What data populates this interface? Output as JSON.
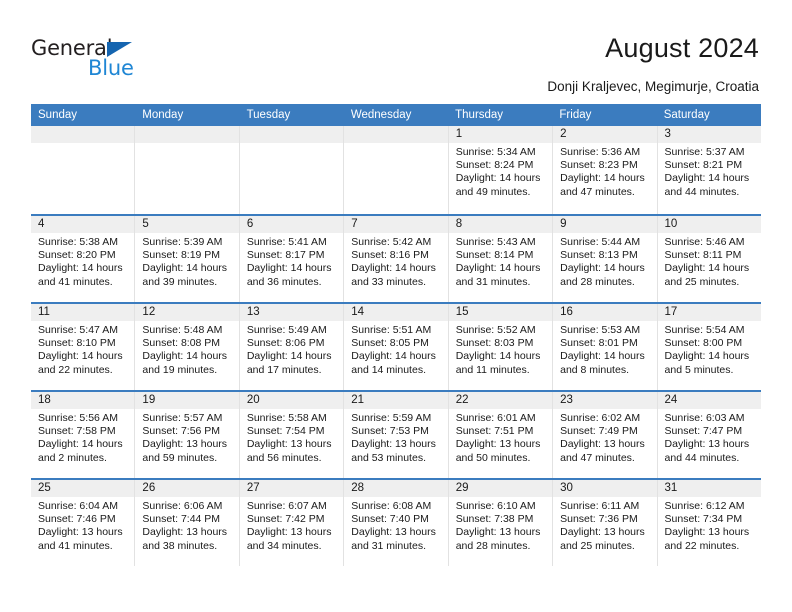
{
  "brand": {
    "name_part1": "General",
    "name_part2": "Blue",
    "flag_color": "#1565b0",
    "blue_color": "#1f86d4"
  },
  "header": {
    "title": "August 2024",
    "subtitle": "Donji Kraljevec, Megimurje, Croatia"
  },
  "calendar": {
    "header_bg": "#3b7cbf",
    "day_number_bg": "#efefef",
    "weekdays": [
      "Sunday",
      "Monday",
      "Tuesday",
      "Wednesday",
      "Thursday",
      "Friday",
      "Saturday"
    ],
    "weeks": [
      [
        {
          "day": "",
          "empty": true
        },
        {
          "day": "",
          "empty": true
        },
        {
          "day": "",
          "empty": true
        },
        {
          "day": "",
          "empty": true
        },
        {
          "day": "1",
          "sunrise": "Sunrise: 5:34 AM",
          "sunset": "Sunset: 8:24 PM",
          "daylight_line1": "Daylight: 14 hours",
          "daylight_line2": "and 49 minutes."
        },
        {
          "day": "2",
          "sunrise": "Sunrise: 5:36 AM",
          "sunset": "Sunset: 8:23 PM",
          "daylight_line1": "Daylight: 14 hours",
          "daylight_line2": "and 47 minutes."
        },
        {
          "day": "3",
          "sunrise": "Sunrise: 5:37 AM",
          "sunset": "Sunset: 8:21 PM",
          "daylight_line1": "Daylight: 14 hours",
          "daylight_line2": "and 44 minutes."
        }
      ],
      [
        {
          "day": "4",
          "sunrise": "Sunrise: 5:38 AM",
          "sunset": "Sunset: 8:20 PM",
          "daylight_line1": "Daylight: 14 hours",
          "daylight_line2": "and 41 minutes."
        },
        {
          "day": "5",
          "sunrise": "Sunrise: 5:39 AM",
          "sunset": "Sunset: 8:19 PM",
          "daylight_line1": "Daylight: 14 hours",
          "daylight_line2": "and 39 minutes."
        },
        {
          "day": "6",
          "sunrise": "Sunrise: 5:41 AM",
          "sunset": "Sunset: 8:17 PM",
          "daylight_line1": "Daylight: 14 hours",
          "daylight_line2": "and 36 minutes."
        },
        {
          "day": "7",
          "sunrise": "Sunrise: 5:42 AM",
          "sunset": "Sunset: 8:16 PM",
          "daylight_line1": "Daylight: 14 hours",
          "daylight_line2": "and 33 minutes."
        },
        {
          "day": "8",
          "sunrise": "Sunrise: 5:43 AM",
          "sunset": "Sunset: 8:14 PM",
          "daylight_line1": "Daylight: 14 hours",
          "daylight_line2": "and 31 minutes."
        },
        {
          "day": "9",
          "sunrise": "Sunrise: 5:44 AM",
          "sunset": "Sunset: 8:13 PM",
          "daylight_line1": "Daylight: 14 hours",
          "daylight_line2": "and 28 minutes."
        },
        {
          "day": "10",
          "sunrise": "Sunrise: 5:46 AM",
          "sunset": "Sunset: 8:11 PM",
          "daylight_line1": "Daylight: 14 hours",
          "daylight_line2": "and 25 minutes."
        }
      ],
      [
        {
          "day": "11",
          "sunrise": "Sunrise: 5:47 AM",
          "sunset": "Sunset: 8:10 PM",
          "daylight_line1": "Daylight: 14 hours",
          "daylight_line2": "and 22 minutes."
        },
        {
          "day": "12",
          "sunrise": "Sunrise: 5:48 AM",
          "sunset": "Sunset: 8:08 PM",
          "daylight_line1": "Daylight: 14 hours",
          "daylight_line2": "and 19 minutes."
        },
        {
          "day": "13",
          "sunrise": "Sunrise: 5:49 AM",
          "sunset": "Sunset: 8:06 PM",
          "daylight_line1": "Daylight: 14 hours",
          "daylight_line2": "and 17 minutes."
        },
        {
          "day": "14",
          "sunrise": "Sunrise: 5:51 AM",
          "sunset": "Sunset: 8:05 PM",
          "daylight_line1": "Daylight: 14 hours",
          "daylight_line2": "and 14 minutes."
        },
        {
          "day": "15",
          "sunrise": "Sunrise: 5:52 AM",
          "sunset": "Sunset: 8:03 PM",
          "daylight_line1": "Daylight: 14 hours",
          "daylight_line2": "and 11 minutes."
        },
        {
          "day": "16",
          "sunrise": "Sunrise: 5:53 AM",
          "sunset": "Sunset: 8:01 PM",
          "daylight_line1": "Daylight: 14 hours",
          "daylight_line2": "and 8 minutes."
        },
        {
          "day": "17",
          "sunrise": "Sunrise: 5:54 AM",
          "sunset": "Sunset: 8:00 PM",
          "daylight_line1": "Daylight: 14 hours",
          "daylight_line2": "and 5 minutes."
        }
      ],
      [
        {
          "day": "18",
          "sunrise": "Sunrise: 5:56 AM",
          "sunset": "Sunset: 7:58 PM",
          "daylight_line1": "Daylight: 14 hours",
          "daylight_line2": "and 2 minutes."
        },
        {
          "day": "19",
          "sunrise": "Sunrise: 5:57 AM",
          "sunset": "Sunset: 7:56 PM",
          "daylight_line1": "Daylight: 13 hours",
          "daylight_line2": "and 59 minutes."
        },
        {
          "day": "20",
          "sunrise": "Sunrise: 5:58 AM",
          "sunset": "Sunset: 7:54 PM",
          "daylight_line1": "Daylight: 13 hours",
          "daylight_line2": "and 56 minutes."
        },
        {
          "day": "21",
          "sunrise": "Sunrise: 5:59 AM",
          "sunset": "Sunset: 7:53 PM",
          "daylight_line1": "Daylight: 13 hours",
          "daylight_line2": "and 53 minutes."
        },
        {
          "day": "22",
          "sunrise": "Sunrise: 6:01 AM",
          "sunset": "Sunset: 7:51 PM",
          "daylight_line1": "Daylight: 13 hours",
          "daylight_line2": "and 50 minutes."
        },
        {
          "day": "23",
          "sunrise": "Sunrise: 6:02 AM",
          "sunset": "Sunset: 7:49 PM",
          "daylight_line1": "Daylight: 13 hours",
          "daylight_line2": "and 47 minutes."
        },
        {
          "day": "24",
          "sunrise": "Sunrise: 6:03 AM",
          "sunset": "Sunset: 7:47 PM",
          "daylight_line1": "Daylight: 13 hours",
          "daylight_line2": "and 44 minutes."
        }
      ],
      [
        {
          "day": "25",
          "sunrise": "Sunrise: 6:04 AM",
          "sunset": "Sunset: 7:46 PM",
          "daylight_line1": "Daylight: 13 hours",
          "daylight_line2": "and 41 minutes."
        },
        {
          "day": "26",
          "sunrise": "Sunrise: 6:06 AM",
          "sunset": "Sunset: 7:44 PM",
          "daylight_line1": "Daylight: 13 hours",
          "daylight_line2": "and 38 minutes."
        },
        {
          "day": "27",
          "sunrise": "Sunrise: 6:07 AM",
          "sunset": "Sunset: 7:42 PM",
          "daylight_line1": "Daylight: 13 hours",
          "daylight_line2": "and 34 minutes."
        },
        {
          "day": "28",
          "sunrise": "Sunrise: 6:08 AM",
          "sunset": "Sunset: 7:40 PM",
          "daylight_line1": "Daylight: 13 hours",
          "daylight_line2": "and 31 minutes."
        },
        {
          "day": "29",
          "sunrise": "Sunrise: 6:10 AM",
          "sunset": "Sunset: 7:38 PM",
          "daylight_line1": "Daylight: 13 hours",
          "daylight_line2": "and 28 minutes."
        },
        {
          "day": "30",
          "sunrise": "Sunrise: 6:11 AM",
          "sunset": "Sunset: 7:36 PM",
          "daylight_line1": "Daylight: 13 hours",
          "daylight_line2": "and 25 minutes."
        },
        {
          "day": "31",
          "sunrise": "Sunrise: 6:12 AM",
          "sunset": "Sunset: 7:34 PM",
          "daylight_line1": "Daylight: 13 hours",
          "daylight_line2": "and 22 minutes."
        }
      ]
    ]
  }
}
